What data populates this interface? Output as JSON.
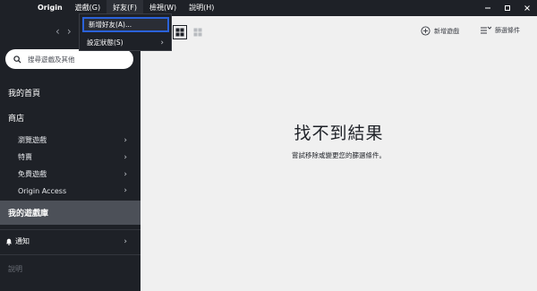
{
  "menu": {
    "items": [
      "Origin",
      "遊戲(G)",
      "好友(F)",
      "檢視(W)",
      "說明(H)"
    ],
    "active_index": 2
  },
  "window_controls": [
    "minimize-icon",
    "maximize-icon",
    "close-icon"
  ],
  "friends_menu": {
    "items": [
      {
        "label": "新增好友(A)...",
        "highlighted": true,
        "has_submenu": false
      },
      {
        "label": "設定狀態(S)",
        "highlighted": false,
        "has_submenu": true
      }
    ]
  },
  "sidebar": {
    "nav_icons": [
      "chevron-left-icon",
      "chevron-right-icon"
    ],
    "search_placeholder": "搜尋遊戲及其他",
    "home": "我的首頁",
    "store": "商店",
    "store_items": [
      {
        "label": "瀏覽遊戲"
      },
      {
        "label": "特賣"
      },
      {
        "label": "免費遊戲"
      },
      {
        "label": "Origin Access"
      }
    ],
    "library": "我的遊戲庫",
    "notifications": "通知",
    "help": "說明"
  },
  "main": {
    "toolbar": {
      "add_game": "新增遊戲",
      "filter": "篩選條件"
    },
    "empty_title": "找不到結果",
    "empty_subtitle": "嘗試移除或變更您的篩選條件。"
  },
  "colors": {
    "sidebar_bg": "#1e2127",
    "selected_bg": "#4c5058",
    "main_bg": "#f0f0f0",
    "highlight_border": "#2b62d9"
  }
}
